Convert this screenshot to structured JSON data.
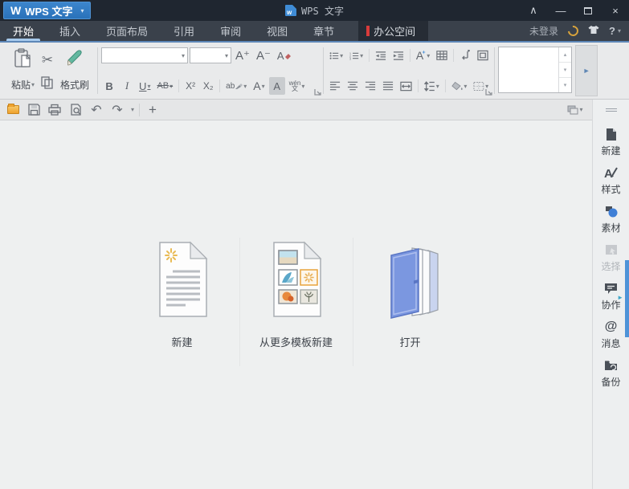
{
  "colors": {
    "titlebar_bg": "#1f2630",
    "menubar_bg": "#3a414b",
    "accent_blue": "#2f7ac2",
    "active_tab_underline": "#a6c9ec",
    "special_tab_marker": "#d93b3b",
    "ribbon_bg": "#e9eaeb",
    "canvas_bg": "#eef0f0",
    "open_folder_orange": "#efa22d",
    "pane_strip_blue": "#4e93d8",
    "gold_icon": "#d8a33c"
  },
  "titlebar": {
    "app_button_label": "WPS 文字",
    "app_logo_glyph": "W",
    "window_title": "WPS 文字",
    "doc_icon_letter": "w",
    "controls": {
      "collapse": "∧",
      "minimize": "—",
      "maximize": "□",
      "close": "×"
    }
  },
  "menubar": {
    "tabs": [
      {
        "label": "开始",
        "active": true
      },
      {
        "label": "插入"
      },
      {
        "label": "页面布局"
      },
      {
        "label": "引用"
      },
      {
        "label": "审阅"
      },
      {
        "label": "视图"
      },
      {
        "label": "章节"
      },
      {
        "label": "办公空间",
        "special": true
      }
    ],
    "login_status": "未登录",
    "help_label": "?"
  },
  "ribbon": {
    "clipboard": {
      "paste_label": "粘贴",
      "format_painter_label": "格式刷"
    },
    "font": {
      "grow": "A⁺",
      "shrink": "A⁻",
      "clear": "A",
      "bold": "B",
      "italic": "I",
      "underline": "U",
      "strikethrough": "AB",
      "superscript": "X²",
      "subscript": "X₂",
      "highlight": "ab",
      "font_color": "A",
      "char_shading": "A",
      "phonetic_top": "wén",
      "phonetic_bottom": "文"
    }
  },
  "quickbar": {
    "new_tab_label": "+"
  },
  "main": {
    "actions": [
      {
        "label": "新建"
      },
      {
        "label": "从更多模板新建"
      },
      {
        "label": "打开"
      }
    ]
  },
  "sidebar": {
    "items": [
      {
        "label": "新建"
      },
      {
        "label": "样式"
      },
      {
        "label": "素材"
      },
      {
        "label": "选择",
        "disabled": true
      },
      {
        "label": "协作"
      },
      {
        "label": "消息"
      },
      {
        "label": "备份"
      }
    ],
    "message_icon_glyph": "@"
  },
  "icons": {
    "scissors": "✂",
    "undo": "↶",
    "redo": "↷",
    "dropdown": "▾",
    "up": "▴",
    "down": "▾",
    "expand_right": "►",
    "pane_arrow": "►"
  }
}
